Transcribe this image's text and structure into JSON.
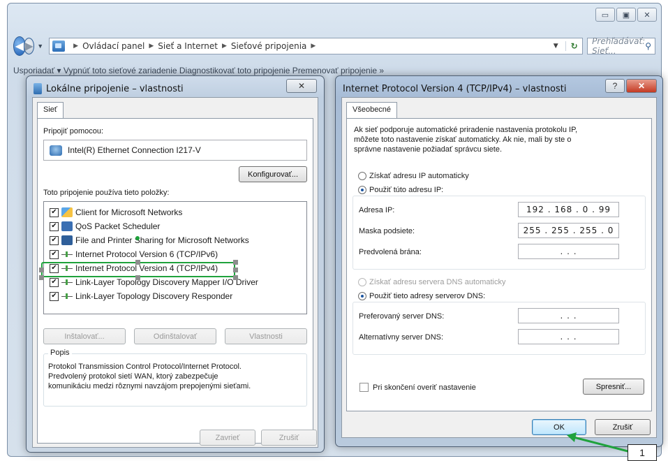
{
  "explorer": {
    "breadcrumbs": [
      "Ovládací panel",
      "Sieť a Internet",
      "Sieťové pripojenia"
    ],
    "search_placeholder": "Prehľadávať: Sieť...",
    "toolbar_text": "Usporiadať ▾   Vypnúť toto sieťové zariadenie   Diagnostikovať toto pripojenie   Premenovať pripojenie   »"
  },
  "left_dialog": {
    "title": "Lokálne pripojenie – vlastnosti",
    "tab": "Sieť",
    "connect_using_label": "Pripojiť pomocou:",
    "adapter": "Intel(R) Ethernet Connection I217-V",
    "configure_button": "Konfigurovať...",
    "items_label": "Toto pripojenie používa tieto položky:",
    "items": [
      {
        "label": "Client for Microsoft Networks",
        "checked": true,
        "icon": "client-icon"
      },
      {
        "label": "QoS Packet Scheduler",
        "checked": true,
        "icon": "qos-icon"
      },
      {
        "label": "File and Printer Sharing for Microsoft Networks",
        "checked": true,
        "icon": "share-icon"
      },
      {
        "label": "Internet Protocol Version 6 (TCP/IPv6)",
        "checked": true,
        "icon": "protocol-icon"
      },
      {
        "label": "Internet Protocol Version 4 (TCP/IPv4)",
        "checked": true,
        "icon": "protocol-icon"
      },
      {
        "label": "Link-Layer Topology Discovery Mapper I/O Driver",
        "checked": true,
        "icon": "protocol-icon"
      },
      {
        "label": "Link-Layer Topology Discovery Responder",
        "checked": true,
        "icon": "protocol-icon"
      }
    ],
    "install_button": "Inštalovať...",
    "uninstall_button": "Odinštalovať",
    "properties_button": "Vlastnosti",
    "description_title": "Popis",
    "description_lines": [
      "Protokol Transmission Control Protocol/Internet Protocol.",
      "Predvolený protokol sietí WAN, ktorý zabezpečuje",
      "komunikáciu medzi rôznymi navzájom prepojenými sieťami."
    ],
    "close_button": "Zavrieť",
    "cancel_button": "Zrušiť"
  },
  "right_dialog": {
    "title": "Internet Protocol Version 4 (TCP/IPv4) – vlastnosti",
    "help_glyph": "?",
    "tab": "Všeobecné",
    "intro_lines": [
      "Ak sieť podporuje automatické priradenie nastavenia protokolu IP,",
      "môžete toto nastavenie získať automaticky. Ak nie, mali by ste o",
      "správne nastavenie požiadať správcu siete."
    ],
    "radio_auto_ip": "Získať adresu IP automaticky",
    "radio_manual_ip": "Použiť túto adresu IP:",
    "ip_label": "Adresa IP:",
    "ip_value": "192 . 168 . 0 . 99",
    "mask_label": "Maska podsiete:",
    "mask_value": "255 . 255 . 255 . 0",
    "gateway_label": "Predvolená brána:",
    "gateway_value": ".      .      .",
    "radio_auto_dns": "Získať adresu servera DNS automaticky",
    "radio_manual_dns": "Použiť tieto adresy serverov DNS:",
    "dns_pref_label": "Preferovaný server DNS:",
    "dns_pref_value": ".      .      .",
    "dns_alt_label": "Alternatívny server DNS:",
    "dns_alt_value": ".      .      .",
    "validate_label": "Pri skončení overiť nastavenie",
    "advanced_button": "Spresniť...",
    "ok_button": "OK",
    "cancel_button": "Zrušiť"
  },
  "annotation": {
    "callout_number": "1",
    "highlight_color": "#1fa23c"
  }
}
